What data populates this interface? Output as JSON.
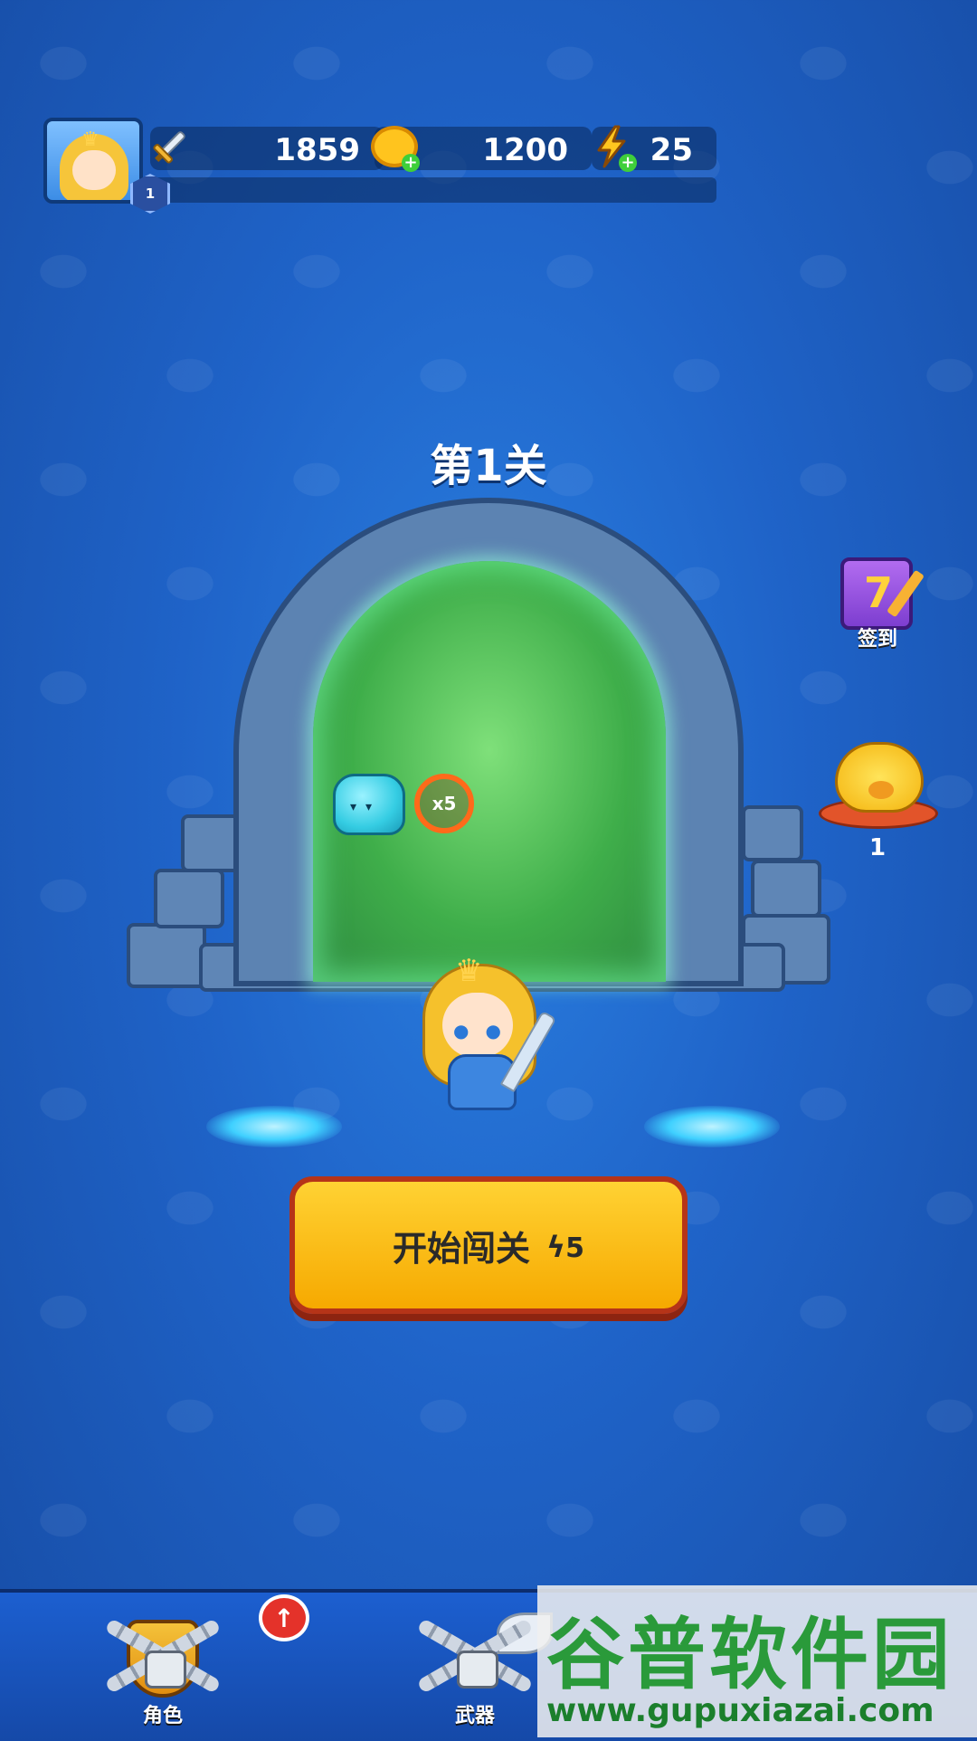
{
  "player": {
    "level": "1",
    "power": "1859",
    "coins": "1200",
    "energy": "25"
  },
  "stage": {
    "title": "第1关",
    "enemy_multiplier": "x5"
  },
  "start_button": {
    "label": "开始闯关",
    "energy_cost": "5"
  },
  "side": {
    "signin_day": "7",
    "signin_label": "签到",
    "piggy_bank_count": "1"
  },
  "bottom_nav": {
    "items": [
      {
        "label": "角色",
        "icon": "character-shield-icon",
        "locked": true
      },
      {
        "label": "武器",
        "icon": "weapon-icon",
        "locked": true
      }
    ]
  },
  "watermark": {
    "text": "谷普软件园",
    "url": "www.gupuxiazai.com"
  },
  "colors": {
    "background": "#1f63c8",
    "button_fill": "#f6a900",
    "button_border": "#b63418",
    "portal_green": "#3fae4a",
    "badge_red": "#e4322a"
  }
}
